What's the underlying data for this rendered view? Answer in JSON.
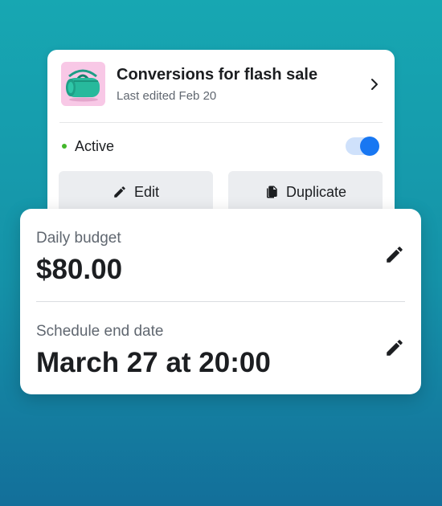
{
  "campaign": {
    "title": "Conversions for flash sale",
    "subtitle": "Last edited Feb 20",
    "thumbnail_icon": "duffel-bag-image",
    "thumbnail_bg": "#f8c8e6",
    "status": {
      "label": "Active",
      "color": "#42b72a",
      "toggle_on": true
    },
    "actions": {
      "edit_label": "Edit",
      "duplicate_label": "Duplicate"
    }
  },
  "details": {
    "budget": {
      "label": "Daily budget",
      "value": "$80.00"
    },
    "schedule": {
      "label": "Schedule end date",
      "value": "March 27 at 20:00"
    }
  },
  "colors": {
    "accent": "#1877f2",
    "background_top": "#17a7b2",
    "background_bottom": "#136f9a"
  }
}
